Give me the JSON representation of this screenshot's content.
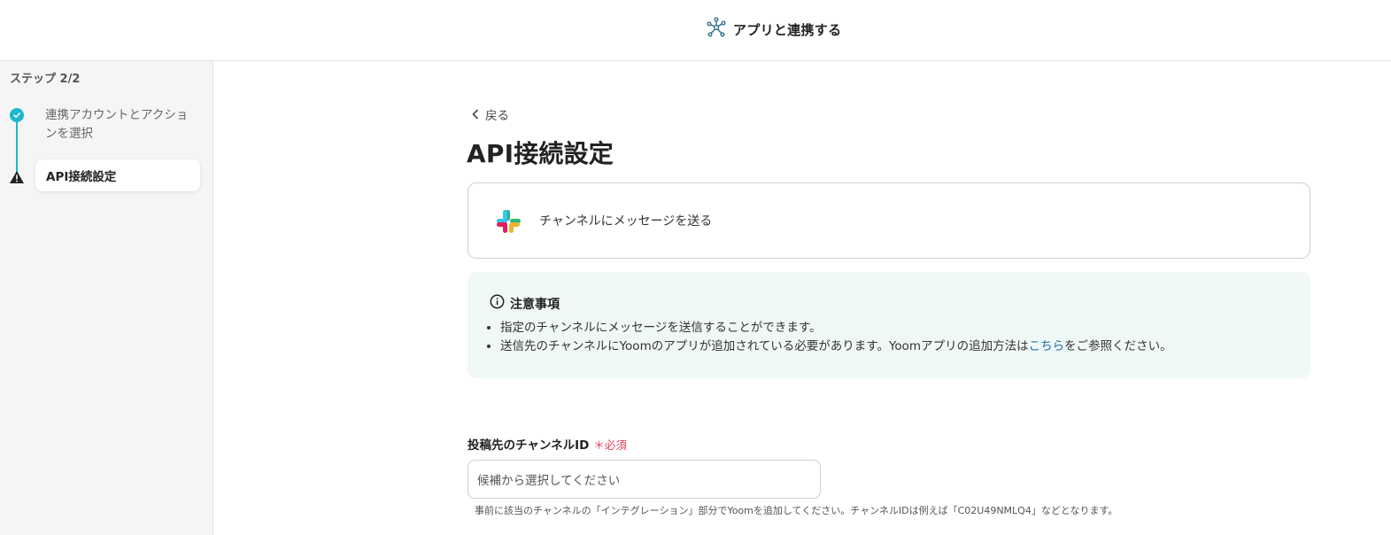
{
  "header": {
    "title": "アプリと連携する",
    "icon": "network-nodes-icon"
  },
  "sidebar": {
    "step_count": "ステップ 2/2",
    "steps": [
      {
        "label": "連携アカウントとアクションを選択",
        "status": "completed"
      },
      {
        "label": "API接続設定",
        "status": "current-warning"
      }
    ]
  },
  "main": {
    "back_label": "戻る",
    "title": "API接続設定",
    "action": {
      "app_icon": "slack-icon",
      "label": "チャンネルにメッセージを送る"
    },
    "notice": {
      "title": "注意事項",
      "items": [
        "指定のチャンネルにメッセージを送信することができます。",
        "送信先のチャンネルにYoomのアプリが追加されている必要があります。Yoomアプリの追加方法は"
      ],
      "item2_link": "こちら",
      "item2_suffix": "をご参照ください。"
    },
    "field": {
      "label": "投稿先のチャンネルID",
      "required_mark": "＊",
      "required_label": "必須",
      "placeholder": "候補から選択してください",
      "help": "事前に該当のチャンネルの「インテグレーション」部分でYoomを追加してください。チャンネルIDは例えば「C02U49NMLQ4」などとなります。"
    }
  },
  "colors": {
    "accent": "#1ab7cf",
    "link": "#1b6fa6",
    "required": "#e0455a",
    "notice_bg": "#eff8f7"
  }
}
